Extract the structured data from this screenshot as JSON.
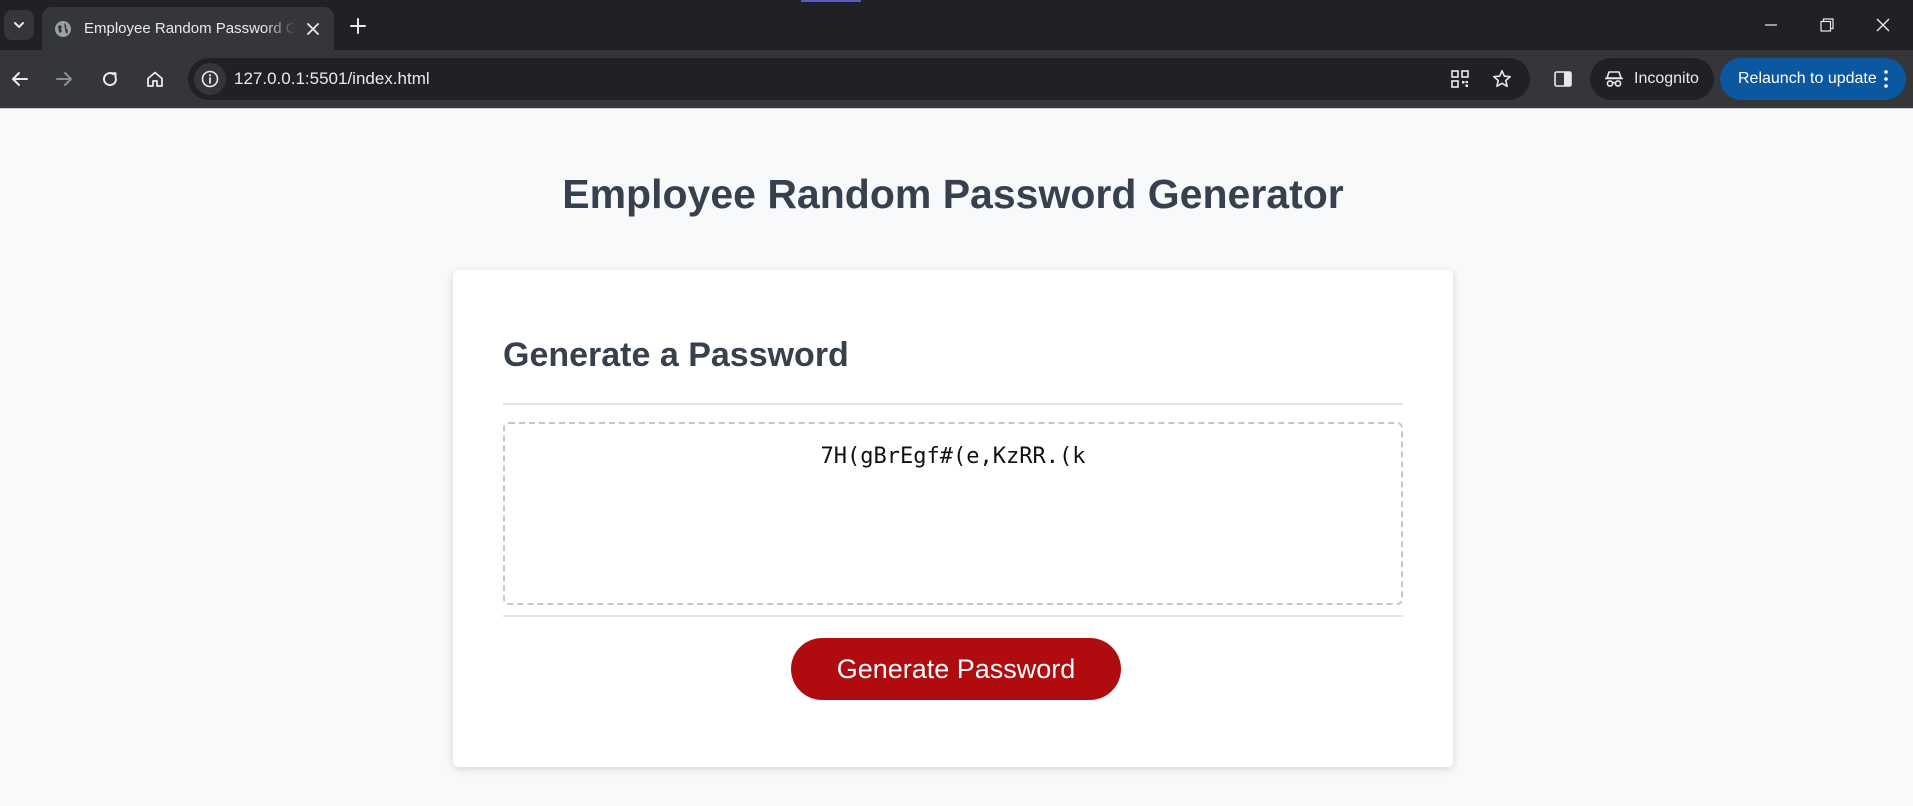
{
  "browser": {
    "tab_title": "Employee Random Password Generator",
    "url": "127.0.0.1:5501/index.html",
    "incognito_label": "Incognito",
    "relaunch_label": "Relaunch to update"
  },
  "page": {
    "title": "Employee Random Password Generator",
    "card_header": "Generate a Password",
    "password_value": "7H(gBrEgf#(e,KzRR.(k",
    "button_label": "Generate Password"
  },
  "colors": {
    "heading": "#37414d",
    "button": "#b00b0e",
    "relaunch": "#0b57a0"
  }
}
